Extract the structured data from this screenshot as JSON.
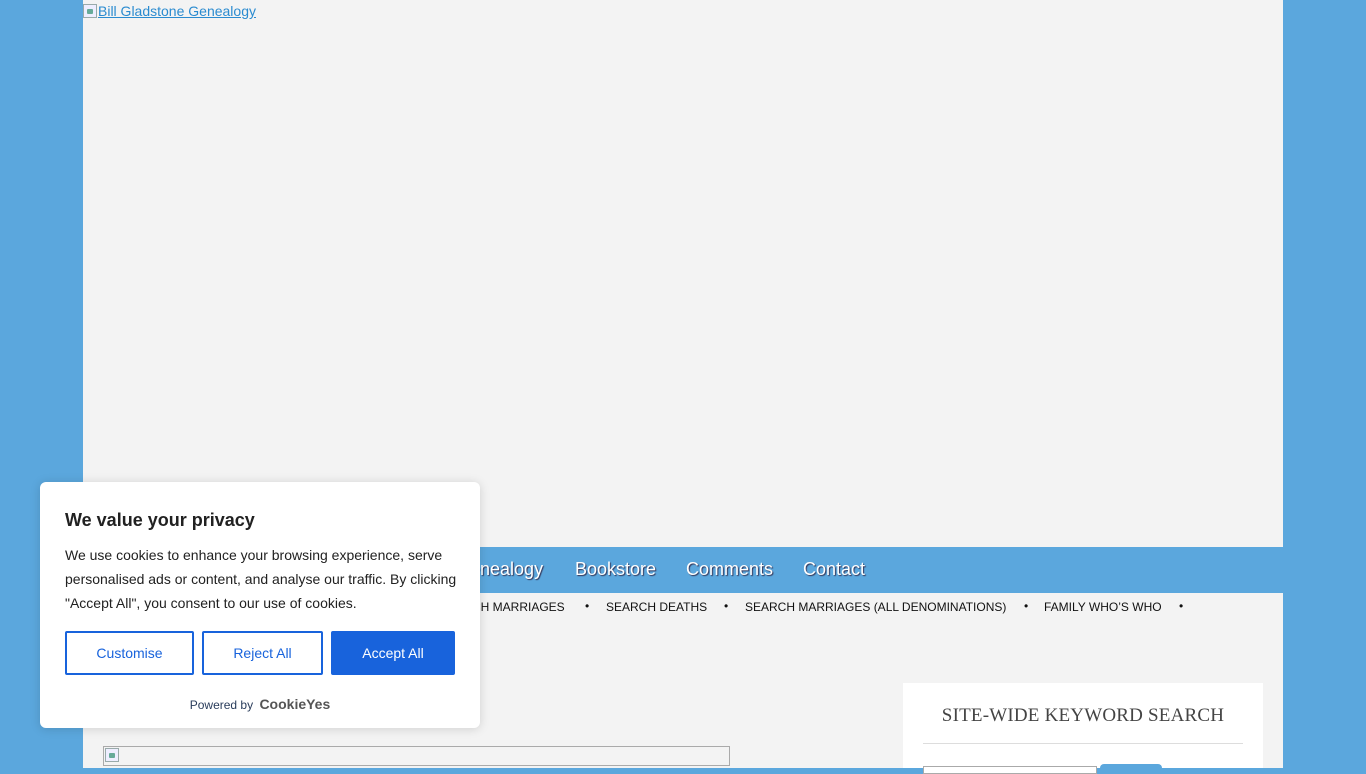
{
  "header": {
    "logo_alt": "Bill Gladstone Genealogy"
  },
  "nav": {
    "items": [
      {
        "label": "enealogy"
      },
      {
        "label": "Bookstore"
      },
      {
        "label": "Comments"
      },
      {
        "label": "Contact"
      }
    ]
  },
  "subnav": {
    "items": [
      {
        "label": "CH MARRIAGES"
      },
      {
        "label": "SEARCH DEATHS"
      },
      {
        "label": "SEARCH MARRIAGES (ALL DENOMINATIONS)"
      },
      {
        "label": "FAMILY WHO’S WHO"
      }
    ],
    "bullet": "•"
  },
  "sidebar": {
    "search_title": "SITE-WIDE KEYWORD SEARCH"
  },
  "cookie": {
    "title": "We value your privacy",
    "text": "We use cookies to enhance your browsing experience, serve personalised ads or content, and analyse our traffic. By clicking \"Accept All\", you consent to our use of cookies.",
    "customise_label": "Customise",
    "reject_label": "Reject All",
    "accept_label": "Accept All",
    "powered_by": "Powered by",
    "brand": "CookieYes"
  },
  "colors": {
    "background": "#5ba7dd",
    "page": "#f3f3f3",
    "accent": "#1863dc",
    "link": "#2a8bd0"
  }
}
